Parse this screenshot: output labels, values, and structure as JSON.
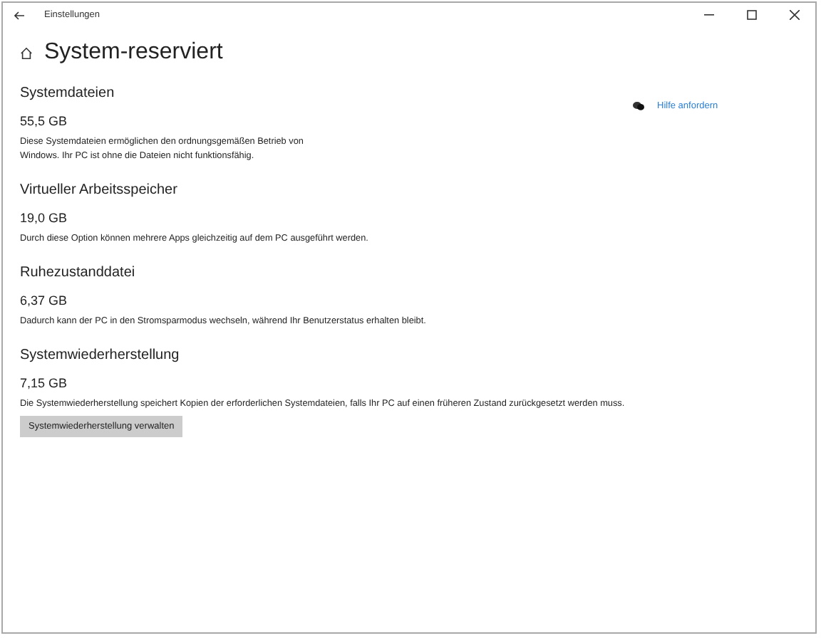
{
  "window": {
    "title": "Einstellungen"
  },
  "page_title": "System-reserviert",
  "help_link": "Hilfe anfordern",
  "sections": [
    {
      "heading": "Systemdateien",
      "size": "55,5 GB",
      "description": "Diese Systemdateien ermöglichen den ordnungsgemäßen Betrieb von Windows. Ihr PC ist ohne die Dateien nicht funktionsfähig.",
      "narrow": true
    },
    {
      "heading": "Virtueller Arbeitsspeicher",
      "size": "19,0 GB",
      "description": "Durch diese Option können mehrere Apps gleichzeitig auf dem PC ausgeführt werden."
    },
    {
      "heading": "Ruhezustanddatei",
      "size": "6,37 GB",
      "description": "Dadurch kann der PC in den Stromsparmodus wechseln, während Ihr Benutzerstatus erhalten bleibt."
    },
    {
      "heading": "Systemwiederherstellung",
      "size": "7,15 GB",
      "description": "Die Systemwiederherstellung speichert Kopien der erforderlichen Systemdateien, falls Ihr PC auf einen früheren Zustand zurückgesetzt werden muss.",
      "button": "Systemwiederherstellung verwalten"
    }
  ]
}
